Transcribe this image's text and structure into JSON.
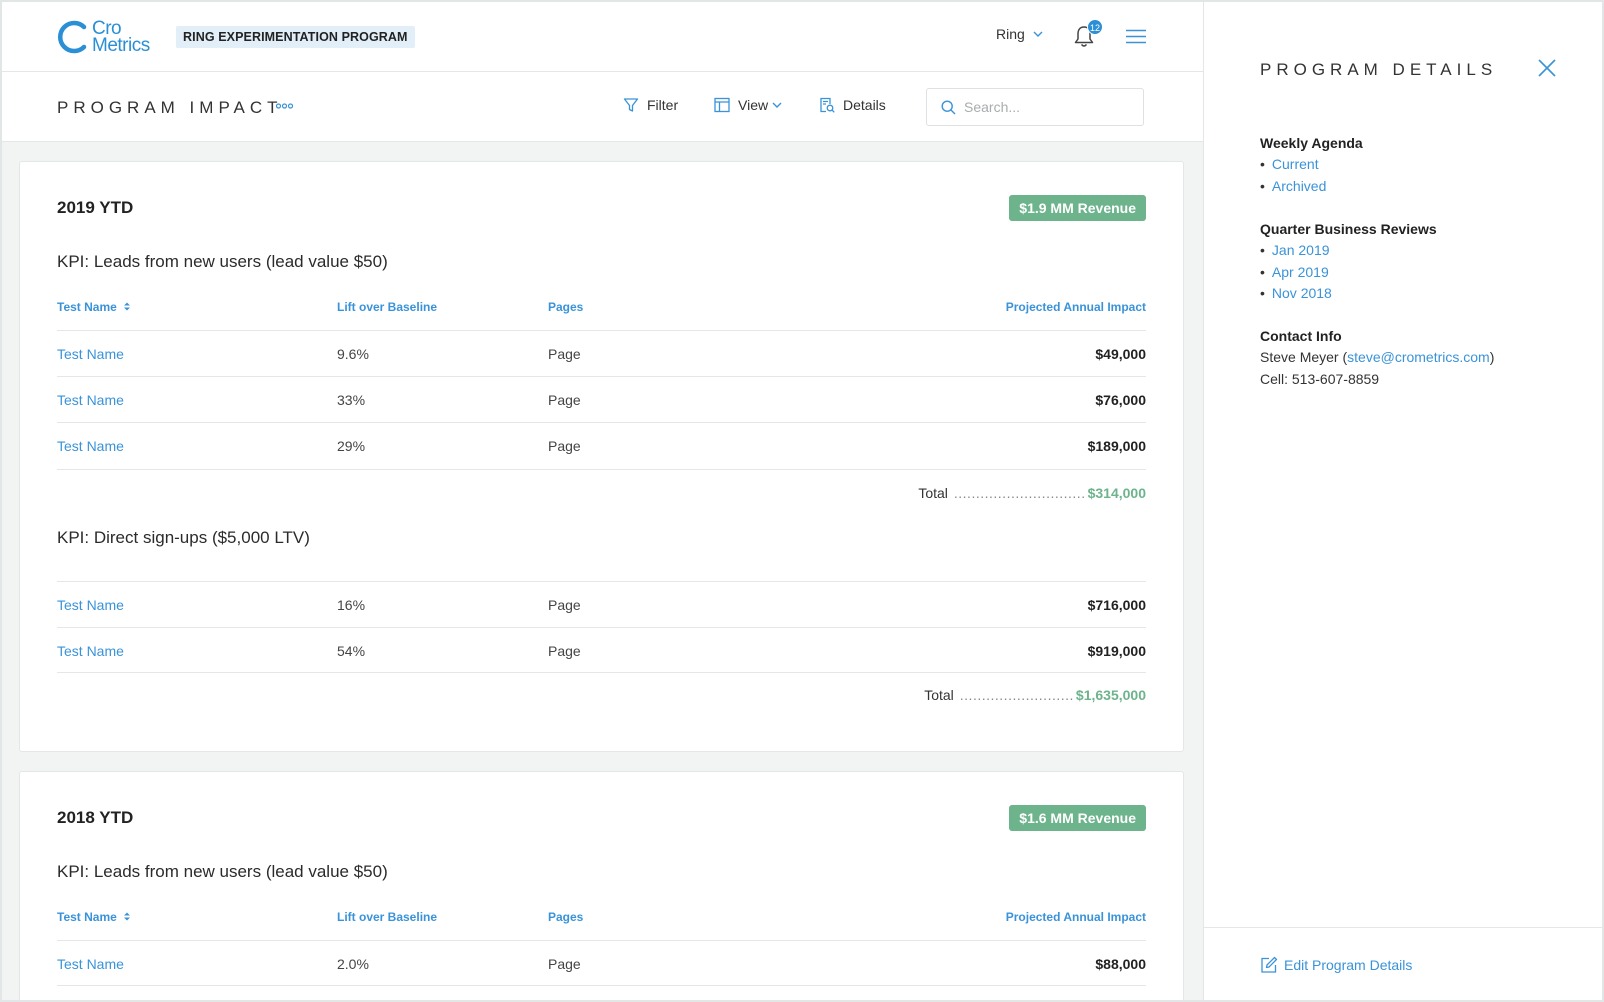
{
  "header": {
    "logo_line1": "Cro",
    "logo_line2": "Metrics",
    "program_name": "RING EXPERIMENTATION PROGRAM",
    "account": "Ring",
    "notification_count": "12"
  },
  "toolbar": {
    "page_title": "PROGRAM IMPACT",
    "filter_label": "Filter",
    "view_label": "View",
    "details_label": "Details",
    "search_placeholder": "Search..."
  },
  "columns": {
    "test_name": "Test Name",
    "lift": "Lift over Baseline",
    "pages": "Pages",
    "impact": "Projected Annual Impact"
  },
  "cards": [
    {
      "title": "2019 YTD",
      "revenue": "$1.9 MM Revenue",
      "kpis": [
        {
          "title": "KPI: Leads from new users (lead value $50)",
          "rows": [
            {
              "name": "Test Name",
              "lift": "9.6%",
              "page": "Page",
              "impact": "$49,000"
            },
            {
              "name": "Test Name",
              "lift": "33%",
              "page": "Page",
              "impact": "$76,000"
            },
            {
              "name": "Test Name",
              "lift": "29%",
              "page": "Page",
              "impact": "$189,000"
            }
          ],
          "total_label": "Total",
          "total_dots": "..............................",
          "total": "$314,000"
        },
        {
          "title": "KPI: Direct sign-ups ($5,000 LTV)",
          "rows": [
            {
              "name": "Test Name",
              "lift": "16%",
              "page": "Page",
              "impact": "$716,000"
            },
            {
              "name": "Test Name",
              "lift": "54%",
              "page": "Page",
              "impact": "$919,000"
            }
          ],
          "total_label": "Total",
          "total_dots": "..........................",
          "total": "$1,635,000"
        }
      ]
    },
    {
      "title": "2018 YTD",
      "revenue": "$1.6 MM Revenue",
      "kpis": [
        {
          "title": "KPI: Leads from new users (lead value $50)",
          "rows": [
            {
              "name": "Test Name",
              "lift": "2.0%",
              "page": "Page",
              "impact": "$88,000"
            }
          ]
        }
      ]
    }
  ],
  "panel": {
    "title": "PROGRAM DETAILS",
    "weekly_agenda": {
      "heading": "Weekly Agenda",
      "items": [
        "Current",
        "Archived"
      ]
    },
    "qbr": {
      "heading": "Quarter Business Reviews",
      "items": [
        "Jan 2019",
        "Apr 2019",
        "Nov 2018"
      ]
    },
    "contact": {
      "heading": "Contact Info",
      "name": "Steve Meyer (",
      "email": "steve@crometrics.com",
      "close_paren": ")",
      "cell": "Cell: 513-607-8859"
    },
    "edit_label": "Edit Program Details"
  },
  "colors": {
    "accent": "#3a93d8",
    "revenue_green": "#6db38c"
  }
}
